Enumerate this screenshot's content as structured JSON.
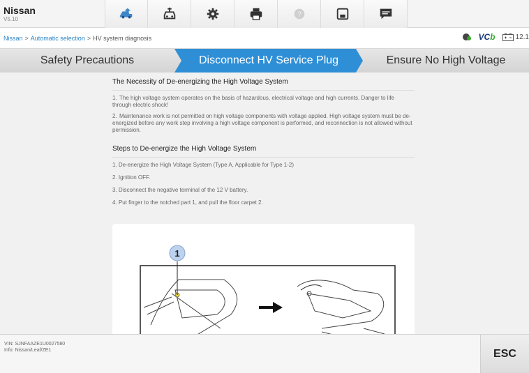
{
  "app": {
    "name": "Nissan",
    "version": "V5.10"
  },
  "toolbar": {
    "items": [
      {
        "icon": "home-car-icon"
      },
      {
        "icon": "car-diagnostics-icon"
      },
      {
        "icon": "settings-gear-icon"
      },
      {
        "icon": "printer-icon"
      },
      {
        "icon": "help-icon"
      },
      {
        "icon": "save-icon"
      },
      {
        "icon": "message-icon"
      }
    ]
  },
  "breadcrumb": {
    "link1": "Nissan",
    "link2": "Automatic selection",
    "current": "HV system diagnosis",
    "sep": ">"
  },
  "status": {
    "vcb_label": "VC",
    "vcb_suffix": "b",
    "battery": "12.1"
  },
  "tabs": [
    {
      "label": "Safety Precautions"
    },
    {
      "label": "Disconnect HV Service Plug",
      "active": true
    },
    {
      "label": "Ensure No High Voltage"
    }
  ],
  "content": {
    "heading1": "The Necessity of De-energizing the High Voltage System",
    "p1_num": "1.",
    "p1": "The high voltage system operates on the basis of hazardous, electrical voltage and high currents. Danger to life through electric shock!",
    "p2_num": "2.",
    "p2": "Maintenance work is not permitted on high voltage components with voltage applied. High voltage system must be de-energized before any work step involving a high voltage component is performed, and reconnection is not allowed without permission.",
    "heading2": "Steps to De-energize the High Voltage System",
    "steps": [
      "1. De-energize the High Voltage System (Type A, Applicable for Type 1-2)",
      "2. Ignition OFF.",
      "3. Disconnect the negative terminal of the 12 V battery.",
      "4. Put finger to the notched part 1, and pull the floor carpet 2."
    ],
    "figure_callout": "1"
  },
  "footer": {
    "vin": "VIN: SJNFAAZE1U0027580",
    "info": "Info: Nissan/Leaf/ZE1",
    "esc_label": "ESC"
  }
}
